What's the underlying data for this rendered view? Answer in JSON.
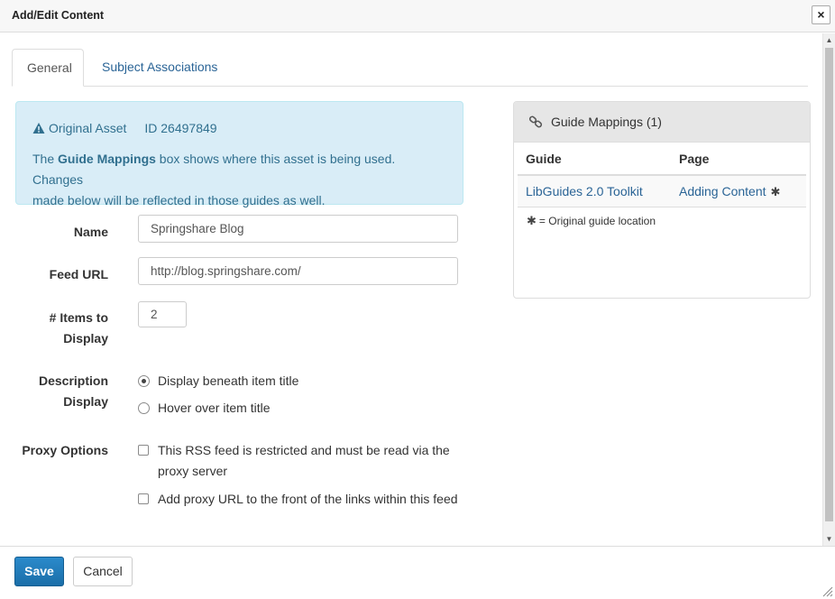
{
  "dialog": {
    "title": "Add/Edit Content",
    "close_label": "×"
  },
  "tabs": [
    {
      "label": "General",
      "active": true
    },
    {
      "label": "Subject Associations",
      "active": false
    }
  ],
  "alert": {
    "heading": "Original Asset",
    "id_text": "ID 26497849",
    "body_pre": "The ",
    "body_bold": "Guide Mappings",
    "body_post_line1": " box shows where this asset is being used. Changes",
    "body_line2": "made below will be reflected in those guides as well."
  },
  "form": {
    "name_label": "Name",
    "name_value": "Springshare Blog",
    "feed_label": "Feed URL",
    "feed_value": "http://blog.springshare.com/",
    "items_label_line1": "# Items to",
    "items_label_line2": "Display",
    "items_value": "2",
    "desc_label_line1": "Description",
    "desc_label_line2": "Display",
    "desc_options": [
      {
        "label": "Display beneath item title",
        "checked": true
      },
      {
        "label": "Hover over item title",
        "checked": false
      }
    ],
    "proxy_label": "Proxy Options",
    "proxy_options": [
      {
        "label_line1": "This RSS feed is restricted and must be read via the",
        "label_line2": "proxy server",
        "checked": false
      },
      {
        "label_line1": "Add proxy URL to the front of the links within this feed",
        "label_line2": "",
        "checked": false
      }
    ]
  },
  "guide_mappings": {
    "title": "Guide Mappings (1)",
    "col_guide": "Guide",
    "col_page": "Page",
    "rows": [
      {
        "guide": "LibGuides 2.0 Toolkit",
        "page": "Adding Content",
        "star": "✱"
      }
    ],
    "legend_star": "✱",
    "legend_text": "= Original guide location"
  },
  "footer": {
    "save_label": "Save",
    "cancel_label": "Cancel"
  },
  "colors": {
    "link": "#2a6496",
    "alert_bg": "#d9edf7",
    "alert_text": "#31708f",
    "save_bg": "#1f7bbd"
  },
  "icons": {
    "close": "close-icon",
    "warning": "warning-icon",
    "link": "link-icon",
    "star": "asterisk-icon"
  }
}
